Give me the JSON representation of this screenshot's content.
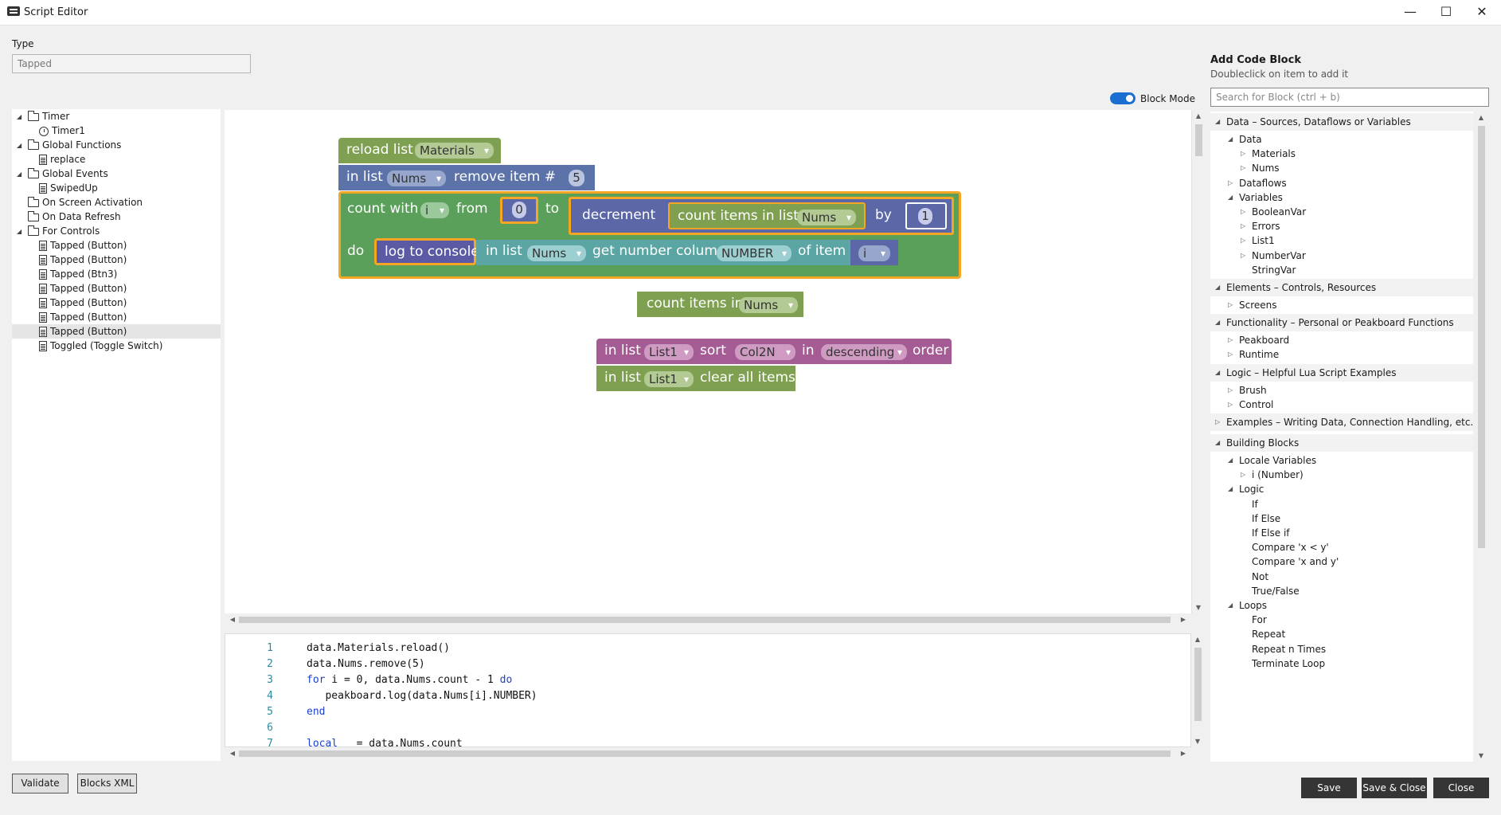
{
  "window": {
    "title": "Script Editor",
    "minimize_glyph": "—",
    "maximize_glyph": "☐",
    "close_glyph": "✕"
  },
  "type_field": {
    "label": "Type",
    "value": "Tapped"
  },
  "script_tree": [
    {
      "label": "Timer",
      "kind": "folder",
      "level": 0,
      "expanded": true
    },
    {
      "label": "Timer1",
      "kind": "timer",
      "level": 1
    },
    {
      "label": "Global Functions",
      "kind": "folder",
      "level": 0,
      "expanded": true
    },
    {
      "label": "replace",
      "kind": "doc",
      "level": 1
    },
    {
      "label": "Global Events",
      "kind": "folder",
      "level": 0,
      "expanded": true
    },
    {
      "label": "SwipedUp",
      "kind": "doc",
      "level": 1
    },
    {
      "label": "On Screen Activation",
      "kind": "folder",
      "level": 0
    },
    {
      "label": "On Data Refresh",
      "kind": "folder",
      "level": 0
    },
    {
      "label": "For Controls",
      "kind": "folder",
      "level": 0,
      "expanded": true
    },
    {
      "label": "Tapped (Button)",
      "kind": "doc",
      "level": 1
    },
    {
      "label": "Tapped (Button)",
      "kind": "doc",
      "level": 1
    },
    {
      "label": "Tapped (Btn3)",
      "kind": "doc",
      "level": 1
    },
    {
      "label": "Tapped (Button)",
      "kind": "doc",
      "level": 1
    },
    {
      "label": "Tapped (Button)",
      "kind": "doc",
      "level": 1
    },
    {
      "label": "Tapped (Button)",
      "kind": "doc",
      "level": 1
    },
    {
      "label": "Tapped (Button)",
      "kind": "doc",
      "level": 1,
      "selected": true
    },
    {
      "label": "Toggled (Toggle Switch)",
      "kind": "doc",
      "level": 1
    }
  ],
  "block_mode": {
    "label": "Block Mode",
    "enabled": true
  },
  "blocks": {
    "reload": {
      "label": "reload list",
      "list": "Materials"
    },
    "remove": {
      "in_list": "in list",
      "list": "Nums",
      "label": "remove item #",
      "index": "5"
    },
    "count_with": {
      "label": "count with",
      "var": "i",
      "from": "from",
      "from_value": "0",
      "to": "to",
      "do": "do"
    },
    "decrement": {
      "label": "decrement",
      "count_items": "count items in list",
      "list": "Nums",
      "by": "by",
      "by_value": "1"
    },
    "log": {
      "label": "log to console",
      "in_list": "in list",
      "list": "Nums",
      "get_column": "get number column",
      "column": "NUMBER",
      "of_item": "of item #",
      "var": "i"
    },
    "count_items_free": {
      "label": "count items in list",
      "list": "Nums"
    },
    "sort": {
      "in_list": "in list",
      "list": "List1",
      "sort": "sort",
      "column": "Col2N",
      "in": "in",
      "direction": "descending",
      "order": "order"
    },
    "clear": {
      "in_list": "in list",
      "list": "List1",
      "label": "clear all items"
    }
  },
  "block_colors": {
    "list": "#7ea050",
    "list_dark": "#5b73a8",
    "loop": "#5aa05a",
    "value": "#5b67a6",
    "console": "#5b5ba5",
    "teal": "#5ba5a5",
    "purple": "#a55b94",
    "highlight": "#f5a623"
  },
  "code_lines": [
    {
      "n": "1",
      "text": "data.Materials.reload()"
    },
    {
      "n": "2",
      "text": "data.Nums.remove(5)"
    },
    {
      "n": "3",
      "text": "for i = 0, data.Nums.count - 1 do"
    },
    {
      "n": "4",
      "text": "   peakboard.log(data.Nums[i].NUMBER)"
    },
    {
      "n": "5",
      "text": "end"
    },
    {
      "n": "6",
      "text": ""
    },
    {
      "n": "7",
      "text": "local _ = data.Nums.count"
    }
  ],
  "add_block": {
    "title": "Add Code Block",
    "subtitle": "Doubleclick on item to add it",
    "search_placeholder": "Search for Block (ctrl + b)",
    "tree": [
      {
        "label": "Data – Sources, Dataflows or Variables",
        "level": 0,
        "arrow": "open",
        "header": true
      },
      {
        "label": "Data",
        "level": 1,
        "arrow": "open"
      },
      {
        "label": "Materials",
        "level": 2,
        "arrow": "closed"
      },
      {
        "label": "Nums",
        "level": 2,
        "arrow": "closed"
      },
      {
        "label": "Dataflows",
        "level": 1,
        "arrow": "closed"
      },
      {
        "label": "Variables",
        "level": 1,
        "arrow": "open"
      },
      {
        "label": "BooleanVar",
        "level": 2,
        "arrow": "closed"
      },
      {
        "label": "Errors",
        "level": 2,
        "arrow": "closed"
      },
      {
        "label": "List1",
        "level": 2,
        "arrow": "closed"
      },
      {
        "label": "NumberVar",
        "level": 2,
        "arrow": "closed"
      },
      {
        "label": "StringVar",
        "level": 2,
        "arrow": "none"
      },
      {
        "label": "Elements – Controls, Resources",
        "level": 0,
        "arrow": "open",
        "header": true
      },
      {
        "label": "Screens",
        "level": 1,
        "arrow": "closed"
      },
      {
        "label": "Functionality – Personal or Peakboard Functions",
        "level": 0,
        "arrow": "open",
        "header": true
      },
      {
        "label": "Peakboard",
        "level": 1,
        "arrow": "closed"
      },
      {
        "label": "Runtime",
        "level": 1,
        "arrow": "closed"
      },
      {
        "label": "Logic – Helpful Lua Script Examples",
        "level": 0,
        "arrow": "open",
        "header": true
      },
      {
        "label": "Brush",
        "level": 1,
        "arrow": "closed"
      },
      {
        "label": "Control",
        "level": 1,
        "arrow": "closed"
      },
      {
        "label": "Examples – Writing Data, Connection Handling, etc.",
        "level": 0,
        "arrow": "closed",
        "header": true
      },
      {
        "label": "Building Blocks",
        "level": 0,
        "arrow": "open",
        "header": true
      },
      {
        "label": "Locale Variables",
        "level": 1,
        "arrow": "open"
      },
      {
        "label": "i (Number)",
        "level": 2,
        "arrow": "closed"
      },
      {
        "label": "Logic",
        "level": 1,
        "arrow": "open"
      },
      {
        "label": "If",
        "level": 2,
        "arrow": "none"
      },
      {
        "label": "If Else",
        "level": 2,
        "arrow": "none"
      },
      {
        "label": "If Else if",
        "level": 2,
        "arrow": "none"
      },
      {
        "label": "Compare 'x < y'",
        "level": 2,
        "arrow": "none"
      },
      {
        "label": "Compare 'x and y'",
        "level": 2,
        "arrow": "none"
      },
      {
        "label": "Not",
        "level": 2,
        "arrow": "none"
      },
      {
        "label": "True/False",
        "level": 2,
        "arrow": "none"
      },
      {
        "label": "Loops",
        "level": 1,
        "arrow": "open"
      },
      {
        "label": "For",
        "level": 2,
        "arrow": "none"
      },
      {
        "label": "Repeat",
        "level": 2,
        "arrow": "none"
      },
      {
        "label": "Repeat n Times",
        "level": 2,
        "arrow": "none"
      },
      {
        "label": "Terminate Loop",
        "level": 2,
        "arrow": "none"
      }
    ]
  },
  "buttons": {
    "validate": "Validate",
    "blocks_xml": "Blocks XML",
    "save": "Save",
    "save_close": "Save & Close",
    "close": "Close"
  }
}
